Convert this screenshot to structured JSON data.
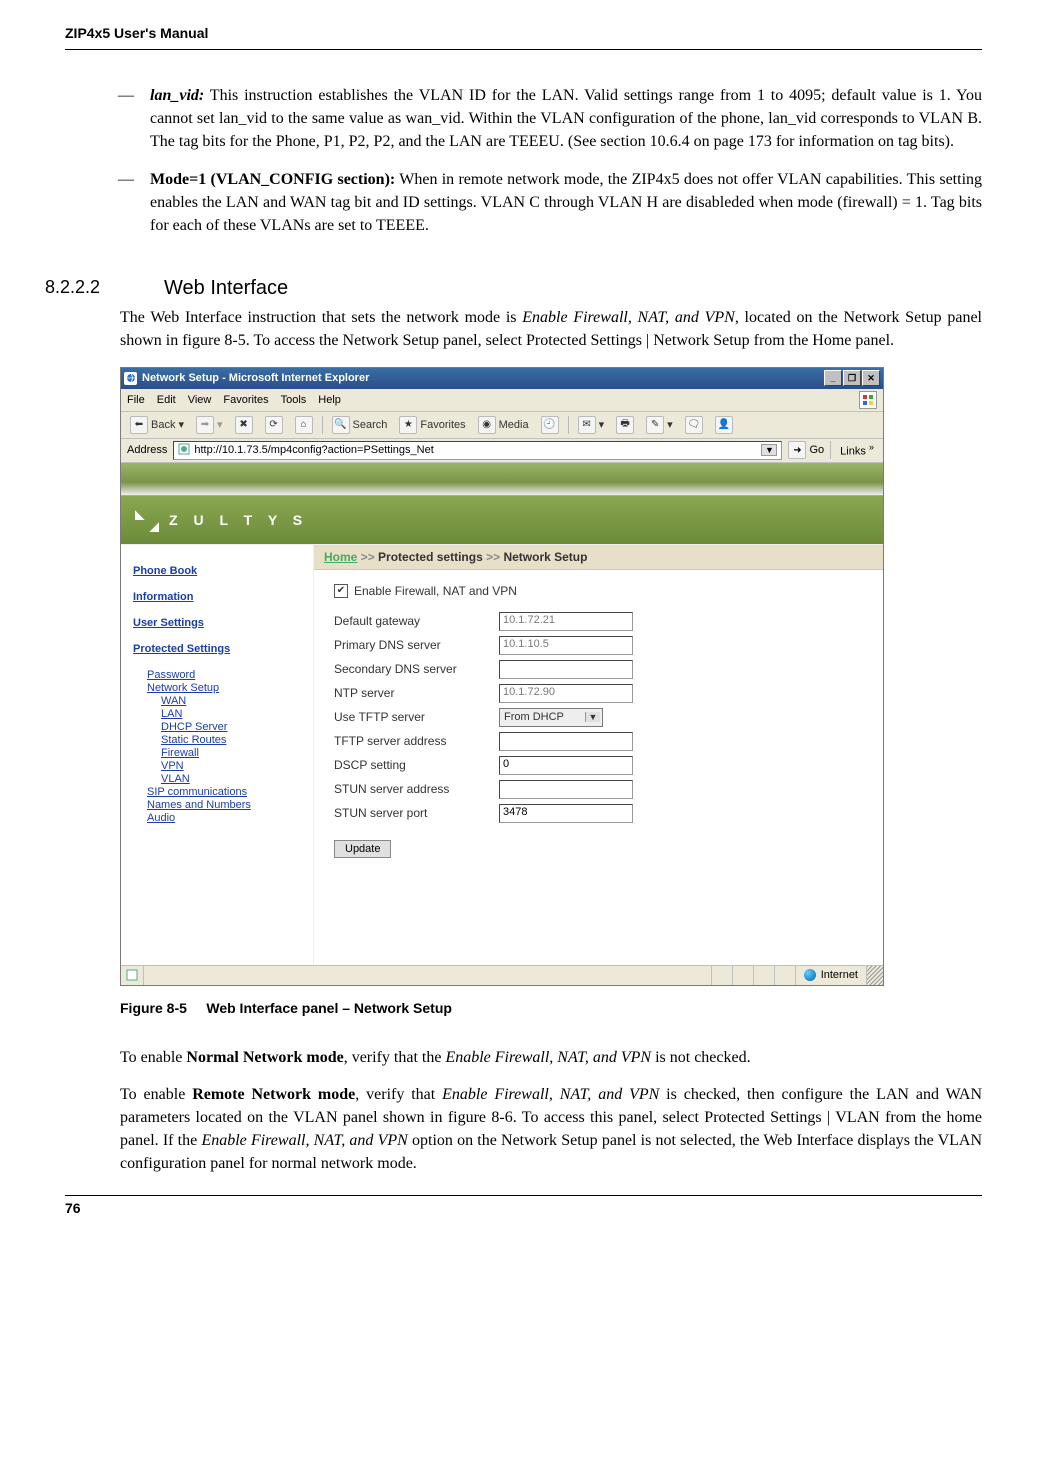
{
  "runningHeader": "ZIP4x5 User's Manual",
  "bullets": [
    {
      "lead": "lan_vid:",
      "leadStyle": "italic-bold",
      "text": " This instruction establishes the VLAN ID for the LAN. Valid settings range from 1 to 4095; default value is 1. You cannot set lan_vid to the same value as wan_vid. Within the VLAN configuration of the phone, lan_vid corresponds to VLAN B. The tag bits for the Phone, P1, P2, P2, and the LAN are TEEEU. (See section 10.6.4 on page 173 for information on tag bits)."
    },
    {
      "lead": "Mode=1 (VLAN_CONFIG section):",
      "leadStyle": "bold",
      "text": " When in remote network mode, the ZIP4x5 does not offer VLAN capabilities. This setting enables the LAN and WAN tag bit and ID settings. VLAN C through VLAN H are disableded when mode (firewall) = 1. Tag bits for each of these VLANs are set to TEEEE."
    }
  ],
  "section": {
    "number": "8.2.2.2",
    "title": "Web Interface"
  },
  "para1_a": "The Web Interface instruction that sets the network mode is ",
  "para1_b": "Enable Firewall, NAT, and VPN",
  "para1_c": ", located on the Network Setup panel shown in figure 8-5. To access the Network Setup panel, select Protected Settings | Network Setup from the Home panel.",
  "browser": {
    "title": "Network Setup - Microsoft Internet Explorer",
    "menus": [
      "File",
      "Edit",
      "View",
      "Favorites",
      "Tools",
      "Help"
    ],
    "toolbar": {
      "back": "Back",
      "search": "Search",
      "favorites": "Favorites",
      "media": "Media"
    },
    "addressLabel": "Address",
    "url": "http://10.1.73.5/mp4config?action=PSettings_Net",
    "go": "Go",
    "links": "Links",
    "brand": "Z U L T Y S",
    "breadcrumb": {
      "home": "Home",
      "seg1": "Protected settings",
      "seg2": "Network Setup",
      "sep": ">>"
    },
    "sidebar": {
      "phoneBook": "Phone Book",
      "information": "Information",
      "userSettings": "User Settings",
      "protected": "Protected Settings",
      "password": "Password",
      "networkSetup": "Network Setup",
      "wan": "WAN",
      "lan": "LAN",
      "dhcp": "DHCP Server",
      "staticRoutes": "Static Routes",
      "firewall": "Firewall",
      "vpn": "VPN",
      "vlan": "VLAN",
      "sip": "SIP communications",
      "names": "Names and Numbers",
      "audio": "Audio"
    },
    "form": {
      "enable": "Enable Firewall, NAT and VPN",
      "defaultGw": {
        "label": "Default gateway",
        "value": "10.1.72.21"
      },
      "primaryDns": {
        "label": "Primary DNS server",
        "value": "10.1.10.5"
      },
      "secondaryDns": {
        "label": "Secondary DNS server",
        "value": ""
      },
      "ntp": {
        "label": "NTP server",
        "value": "10.1.72.90"
      },
      "useTftp": {
        "label": "Use TFTP server",
        "value": "From DHCP"
      },
      "tftpAddr": {
        "label": "TFTP server address",
        "value": ""
      },
      "dscp": {
        "label": "DSCP setting",
        "value": "0"
      },
      "stunAddr": {
        "label": "STUN server address",
        "value": ""
      },
      "stunPort": {
        "label": "STUN server port",
        "value": "3478"
      },
      "update": "Update"
    },
    "status": {
      "internet": "Internet"
    }
  },
  "figure": {
    "label": "Figure 8-5",
    "caption": "Web Interface panel – Network Setup"
  },
  "para2_a": "To enable ",
  "para2_b": "Normal Network mode",
  "para2_c": ", verify that the ",
  "para2_d": "Enable Firewall, NAT, and VPN",
  "para2_e": " is not checked.",
  "para3_a": "To enable ",
  "para3_b": "Remote Network mode",
  "para3_c": ", verify that ",
  "para3_d": "Enable Firewall, NAT, and VPN",
  "para3_e": " is checked, then configure the LAN and WAN parameters located on the VLAN panel shown in figure 8-6. To access this panel, select Protected Settings | VLAN from the home panel. If the ",
  "para3_f": "Enable Firewall, NAT, and VPN",
  "para3_g": " option on the Network Setup panel is not selected, the Web Interface displays the VLAN configuration panel for normal network mode.",
  "pageNumber": "76"
}
